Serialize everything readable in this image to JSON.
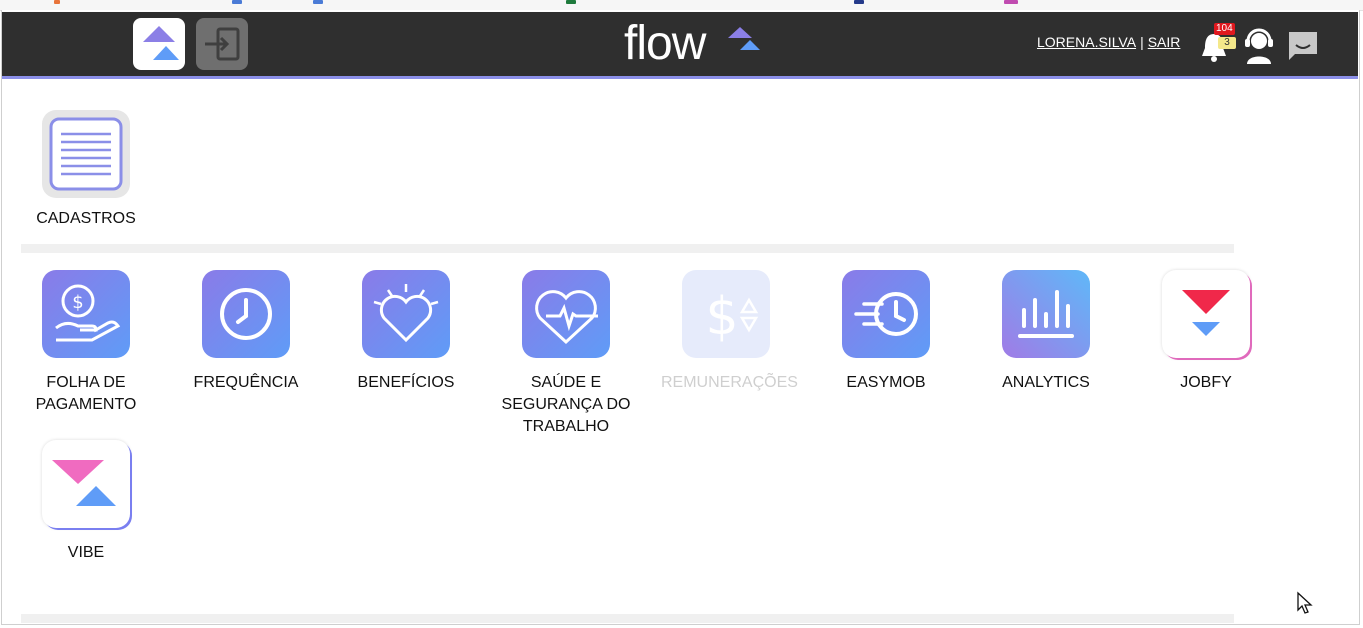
{
  "header": {
    "logo_text": "flow",
    "user_name": "LORENA.SILVA",
    "separator": "|",
    "logout_label": "SAIR",
    "notifications_count": "104",
    "messages_count": "3"
  },
  "colors": {
    "header_bg": "#2f2f2f",
    "accent": "#8b8fe8",
    "icon_gradient_start": "#8a7be8",
    "icon_gradient_end": "#5f9cf7",
    "jobfy_red": "#f0284a",
    "vibe_pink": "#f06bc0"
  },
  "sections": {
    "cadastros": {
      "label": "CADASTROS",
      "icon": "list-icon"
    },
    "apps": [
      {
        "label_line1": "FOLHA DE",
        "label_line2": "PAGAMENTO",
        "label_line3": "",
        "icon": "money-hand-icon",
        "enabled": true
      },
      {
        "label_line1": "FREQUÊNCIA",
        "label_line2": "",
        "label_line3": "",
        "icon": "clock-icon",
        "enabled": true
      },
      {
        "label_line1": "BENEFÍCIOS",
        "label_line2": "",
        "label_line3": "",
        "icon": "heart-icon",
        "enabled": true
      },
      {
        "label_line1": "SAÚDE E",
        "label_line2": "SEGURANÇA DO",
        "label_line3": "TRABALHO",
        "icon": "heartbeat-icon",
        "enabled": true
      },
      {
        "label_line1": "REMUNERAÇÕES",
        "label_line2": "",
        "label_line3": "",
        "icon": "dollar-sort-icon",
        "enabled": false
      },
      {
        "label_line1": "EASYMOB",
        "label_line2": "",
        "label_line3": "",
        "icon": "fast-clock-icon",
        "enabled": true
      },
      {
        "label_line1": "ANALYTICS",
        "label_line2": "",
        "label_line3": "",
        "icon": "bar-chart-icon",
        "enabled": true
      },
      {
        "label_line1": "JOBFY",
        "label_line2": "",
        "label_line3": "",
        "icon": "jobfy-logo-icon",
        "enabled": true
      }
    ],
    "vibe": {
      "label": "VIBE",
      "icon": "vibe-logo-icon"
    }
  }
}
